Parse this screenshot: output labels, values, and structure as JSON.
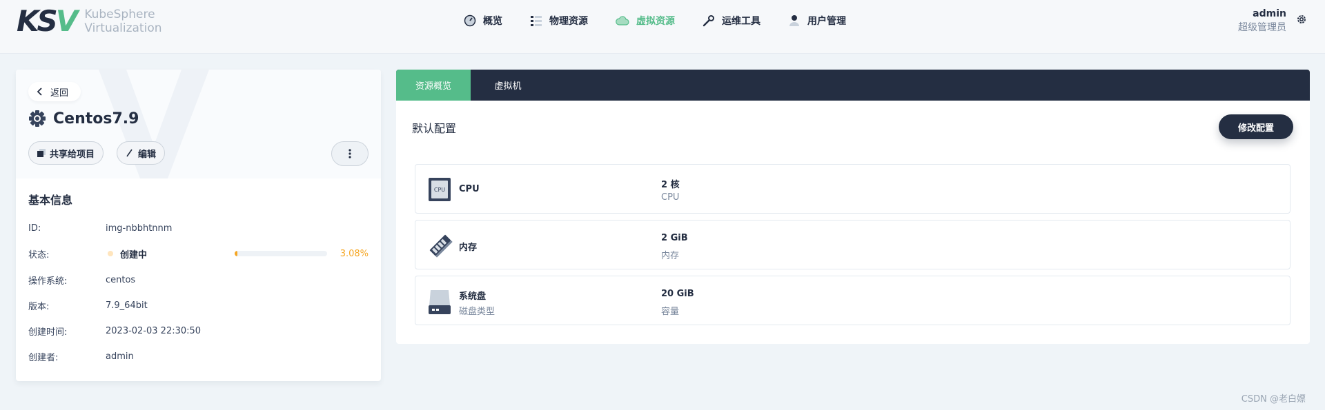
{
  "header": {
    "logo_text_line1": "KubeSphere",
    "logo_text_line2": "Virtualization",
    "nav": [
      {
        "label": "概览",
        "icon": "dashboard-icon"
      },
      {
        "label": "物理资源",
        "icon": "list-icon"
      },
      {
        "label": "虚拟资源",
        "icon": "cloud-icon",
        "active": true
      },
      {
        "label": "运维工具",
        "icon": "wrench-icon"
      },
      {
        "label": "用户管理",
        "icon": "user-icon"
      }
    ],
    "user": {
      "name": "admin",
      "role": "超级管理员"
    }
  },
  "left": {
    "back_label": "返回",
    "title": "Centos7.9",
    "share_label": "共享给项目",
    "edit_label": "编辑",
    "info_title": "基本信息",
    "info": {
      "id_label": "ID:",
      "id_value": "img-nbbhtnnm",
      "status_label": "状态:",
      "status_value": "创建中",
      "status_progress": 0.0308,
      "status_percent": "3.08%",
      "os_label": "操作系统:",
      "os_value": "centos",
      "version_label": "版本:",
      "version_value": "7.9_64bit",
      "created_label": "创建时间:",
      "created_value": "2023-02-03 22:30:50",
      "creator_label": "创建者:",
      "creator_value": "admin"
    }
  },
  "right": {
    "tabs": [
      "资源概览",
      "虚拟机"
    ],
    "section_title": "默认配置",
    "edit_config_label": "修改配置",
    "resources": [
      {
        "name": "CPU",
        "sub": "",
        "value": "2 核",
        "value_sub": "CPU",
        "icon": "cpu-icon"
      },
      {
        "name": "内存",
        "sub": "",
        "value": "2 GiB",
        "value_sub": "内存",
        "icon": "memory-icon"
      },
      {
        "name": "系统盘",
        "sub": "磁盘类型",
        "value": "20 GiB",
        "value_sub": "容量",
        "icon": "disk-icon"
      }
    ],
    "cpu_chip_text": "CPU"
  },
  "footer_text": "CSDN @老白嫖",
  "colors": {
    "accent": "#55bc8a",
    "dark": "#242e42",
    "warning": "#f5a623"
  }
}
